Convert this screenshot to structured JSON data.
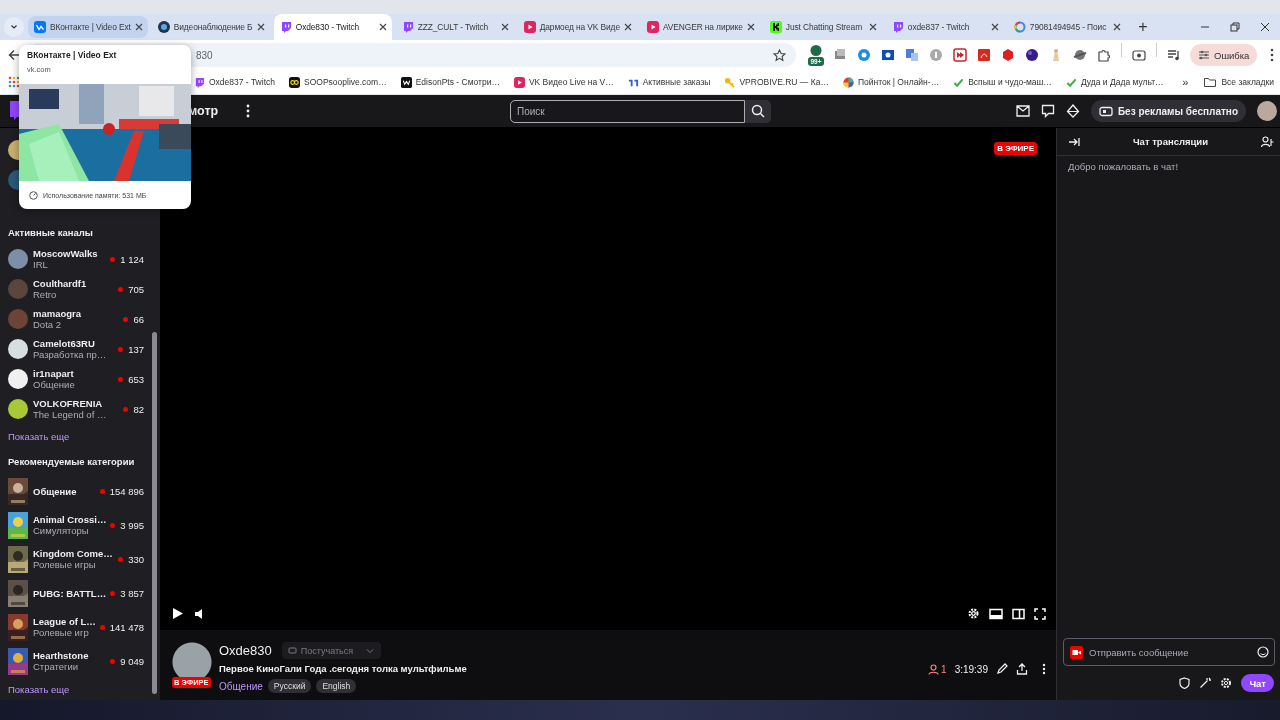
{
  "browser": {
    "tabs": [
      {
        "kind": "vk",
        "title": "ВКонтакте | Video Ext",
        "selected": false,
        "hovered": true
      },
      {
        "kind": "camera",
        "title": "Видеонаблюдение Б",
        "selected": false,
        "hovered": false
      },
      {
        "kind": "twitch",
        "title": "Oxde830 - Twitch",
        "selected": true,
        "hovered": false
      },
      {
        "kind": "twitch",
        "title": "ZZZ_CULT - Twitch",
        "selected": false,
        "hovered": false
      },
      {
        "kind": "vkvideo",
        "title": "Дармоед на VK Виде",
        "selected": false,
        "hovered": false
      },
      {
        "kind": "vkvideo",
        "title": "AVENGER на лирике",
        "selected": false,
        "hovered": false
      },
      {
        "kind": "kick",
        "title": "Just Chatting Stream",
        "selected": false,
        "hovered": false
      },
      {
        "kind": "twitch",
        "title": "oxde837 - Twitch",
        "selected": false,
        "hovered": false
      },
      {
        "kind": "google",
        "title": "79081494945 - Поис",
        "selected": false,
        "hovered": false
      }
    ],
    "new_tab": "+",
    "address": "830",
    "extension_badge": "99+",
    "profile_button": "Ошибка",
    "bookmarks": [
      {
        "kind": "twitch",
        "title": "Oxde837 - Twitch"
      },
      {
        "kind": "soop",
        "title": "SOOPsooplive.com…"
      },
      {
        "kind": "w",
        "title": "EdisonPts - Смотри…"
      },
      {
        "kind": "vkvideo",
        "title": "VK Видео Live на V…"
      },
      {
        "kind": "ya",
        "title": "Активные заказы"
      },
      {
        "kind": "key",
        "title": "VPROBIVE.RU — Ка…"
      },
      {
        "kind": "ball",
        "title": "Пойнток | Онлайн-…"
      },
      {
        "kind": "check",
        "title": "Вспыш и чудо-маш…"
      },
      {
        "kind": "check",
        "title": "Дуда и Дада мульт…"
      }
    ],
    "more_bookmarks": "»",
    "all_bookmarks": "Все закладки"
  },
  "tab_preview": {
    "title": "ВКонтакте | Video Ext",
    "domain": "vk.com",
    "memory": "Использование памяти: 531 МБ"
  },
  "topnav": {
    "browse": "мотр",
    "search": {
      "placeholder": "Поиск"
    },
    "turbo": "Без рекламы бесплатно"
  },
  "sidebar": {
    "sections": [
      {
        "kind": "channel",
        "title": "Активные каналы",
        "items": [
          {
            "name": "MoscowWalks",
            "subtitle": "IRL",
            "viewers": "1 124"
          },
          {
            "name": "Coulthardf1",
            "subtitle": "Retro",
            "viewers": "705"
          },
          {
            "name": "mamaogra",
            "subtitle": "Dota 2",
            "viewers": "66"
          },
          {
            "name": "Camelot63RU",
            "subtitle": "Разработка пр…",
            "viewers": "137"
          },
          {
            "name": "ir1napart",
            "subtitle": "Общение",
            "viewers": "653"
          },
          {
            "name": "VOLKOFRENIA",
            "subtitle": "The Legend of …",
            "viewers": "82"
          }
        ],
        "show_more": "Показать еще"
      },
      {
        "kind": "category",
        "title": "Рекомендуемые категории",
        "items": [
          {
            "name": "Общение",
            "viewers": "154 896"
          },
          {
            "name": "Animal Crossi…",
            "subtitle": "Симуляторы",
            "viewers": "3 995"
          },
          {
            "name": "Kingdom Come…",
            "subtitle": "Ролевые игры",
            "viewers": "330"
          },
          {
            "name": "PUBG: BATTL…",
            "viewers": "3 857"
          },
          {
            "name": "League of L…",
            "subtitle": "Ролевые игр",
            "viewers": "141 478"
          },
          {
            "name": "Hearthstone",
            "subtitle": "Стратегии",
            "viewers": "9 049"
          }
        ],
        "show_more": "Показать еще"
      }
    ]
  },
  "player": {
    "live_badge": "В ЭФИРЕ"
  },
  "stream": {
    "channel": "Oxde830",
    "knock": {
      "label": "Постучаться",
      "disabled": true
    },
    "live_badge": "В ЭФИРЕ",
    "title": "Первое КиноГали Года .сегодня толка мультфильме",
    "category": "Общение",
    "tags": [
      "Русский",
      "English"
    ],
    "viewers": "1",
    "uptime": "3:19:39"
  },
  "chat": {
    "title": "Чат трансляции",
    "welcome": "Добро пожаловать в чат!",
    "input": {
      "placeholder": "Отправить сообщение"
    },
    "send": "Чат"
  }
}
